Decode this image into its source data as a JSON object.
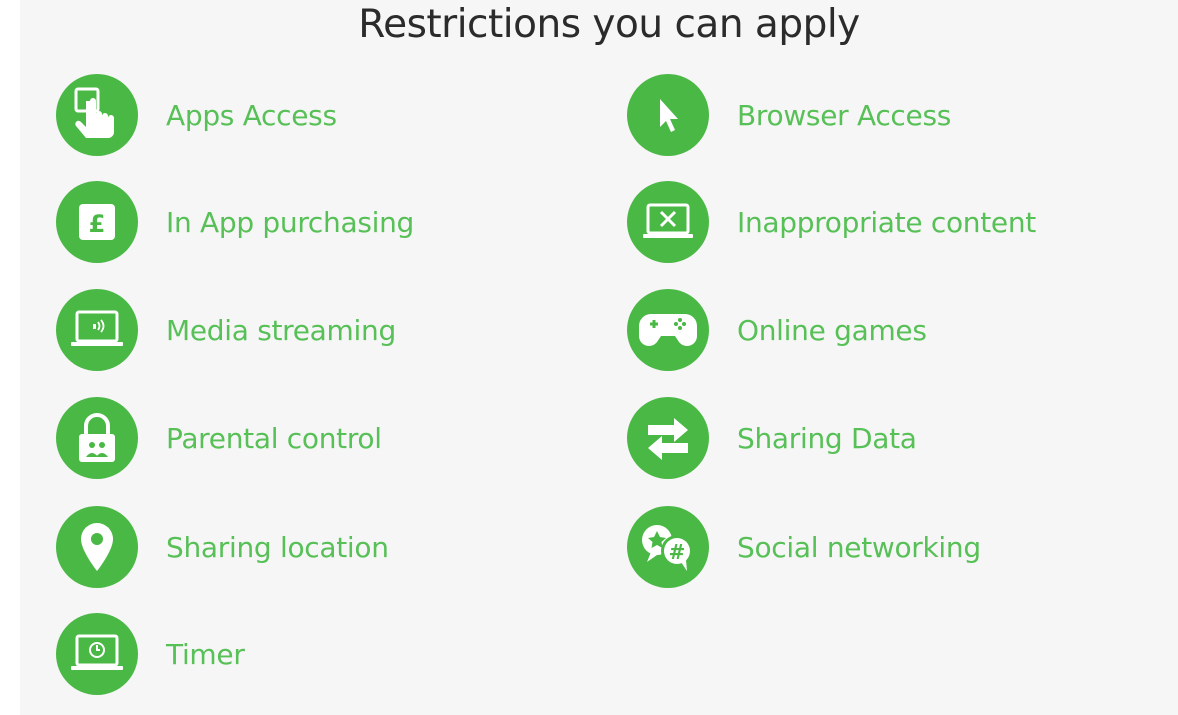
{
  "page": {
    "title": "Restrictions you can apply",
    "accent_color": "#4ab845",
    "label_color": "#57c057"
  },
  "items": [
    {
      "label": "Apps Access",
      "icon": "hand-pointer-icon"
    },
    {
      "label": "Browser Access",
      "icon": "cursor-arrow-icon"
    },
    {
      "label": "In App purchasing",
      "icon": "pound-sign-icon"
    },
    {
      "label": "Inappropriate content",
      "icon": "blocked-screen-icon"
    },
    {
      "label": "Media streaming",
      "icon": "laptop-stream-icon"
    },
    {
      "label": "Online games",
      "icon": "gamepad-icon"
    },
    {
      "label": "Parental control",
      "icon": "padlock-icon"
    },
    {
      "label": "Sharing Data",
      "icon": "exchange-arrows-icon"
    },
    {
      "label": "Sharing location",
      "icon": "map-pin-icon"
    },
    {
      "label": "Social networking",
      "icon": "chat-hashtag-icon"
    },
    {
      "label": "Timer",
      "icon": "laptop-clock-icon"
    }
  ]
}
